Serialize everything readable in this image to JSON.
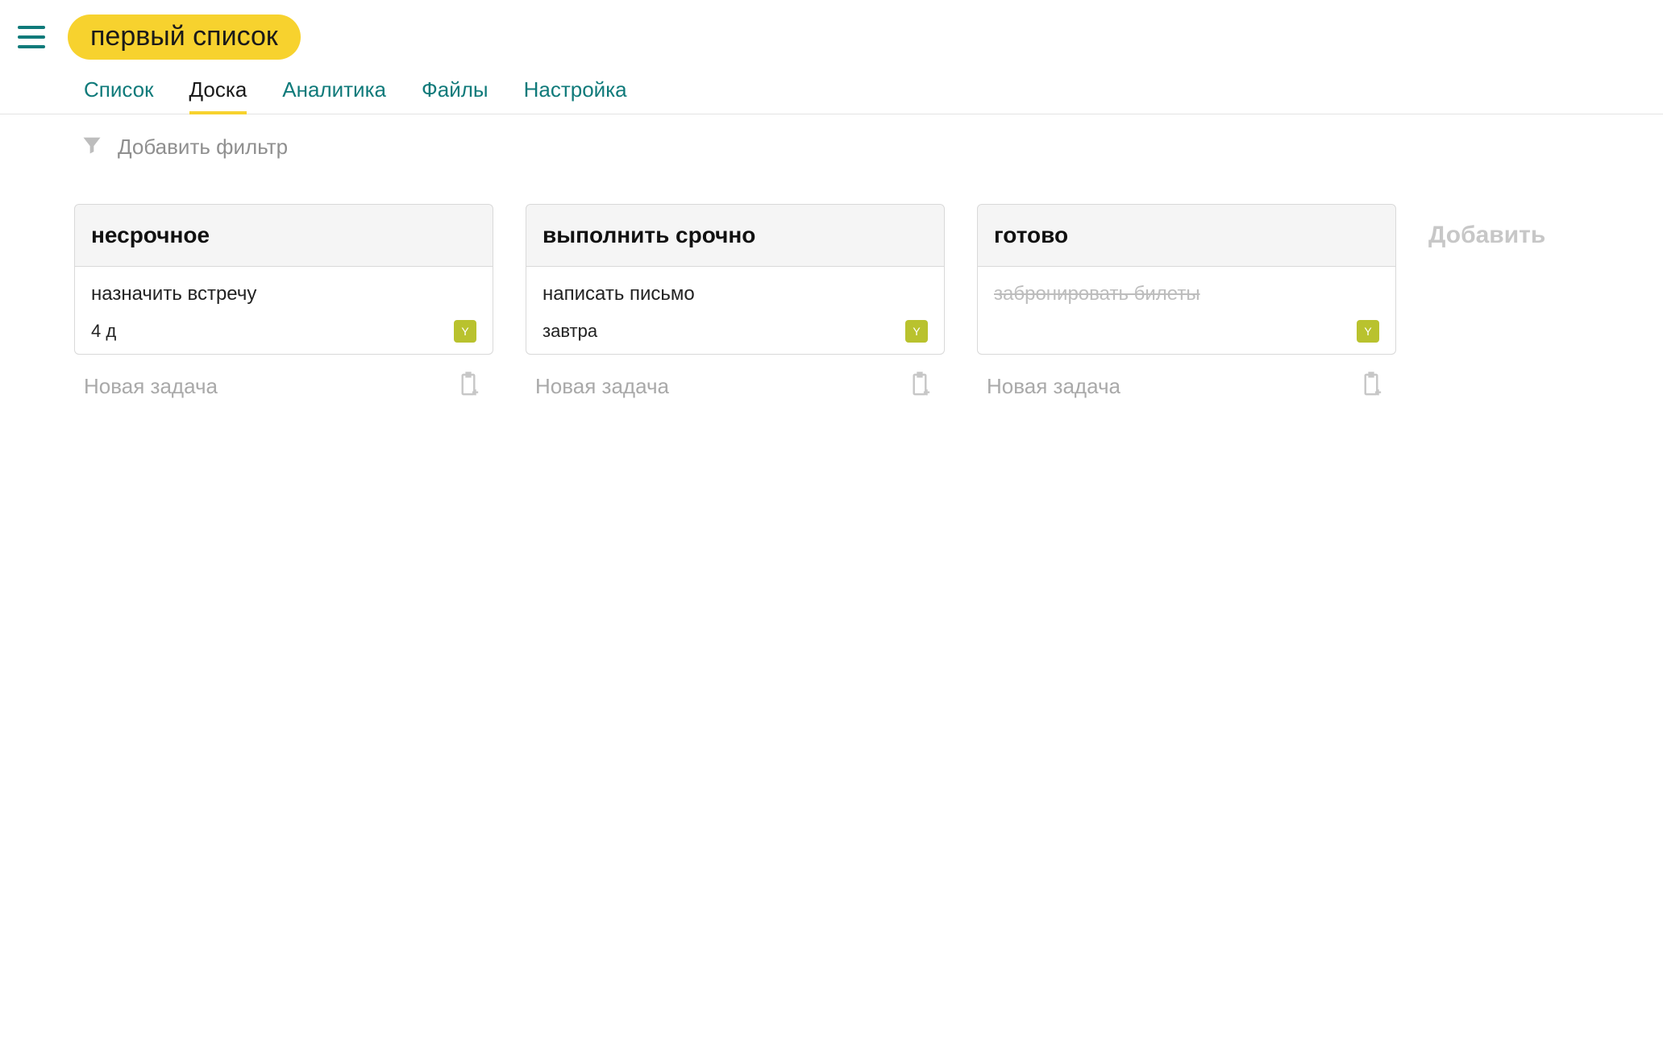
{
  "header": {
    "title": "первый список"
  },
  "tabs": [
    {
      "label": "Список",
      "active": false
    },
    {
      "label": "Доска",
      "active": true
    },
    {
      "label": "Аналитика",
      "active": false
    },
    {
      "label": "Файлы",
      "active": false
    },
    {
      "label": "Настройка",
      "active": false
    }
  ],
  "filter": {
    "placeholder": "Добавить фильтр"
  },
  "board": {
    "add_column_label": "Добавить",
    "new_task_label": "Новая задача",
    "avatar_initial": "Y",
    "columns": [
      {
        "title": "несрочное",
        "card": {
          "title": "назначить встречу",
          "meta": "4 д",
          "done": false
        }
      },
      {
        "title": "выполнить срочно",
        "card": {
          "title": "написать письмо",
          "meta": "завтра",
          "done": false
        }
      },
      {
        "title": "готово",
        "card": {
          "title": "забронировать билеты",
          "meta": "",
          "done": true
        }
      }
    ]
  }
}
